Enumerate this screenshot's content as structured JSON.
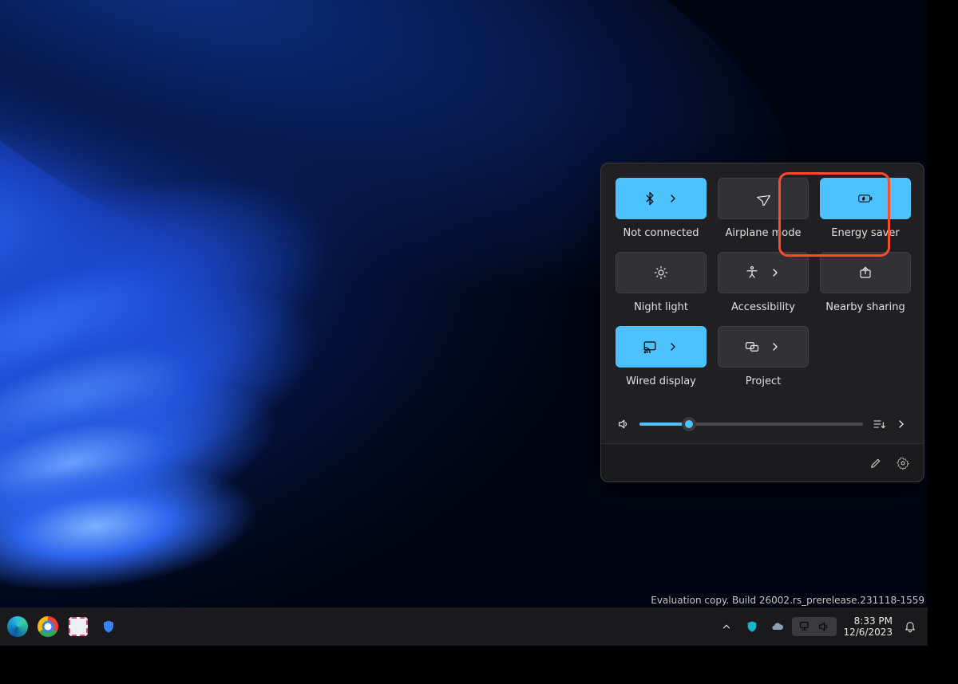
{
  "quick_settings": {
    "tiles": [
      {
        "id": "bluetooth",
        "label": "Not connected",
        "active": true,
        "has_more": true,
        "icon": "bluetooth"
      },
      {
        "id": "airplane",
        "label": "Airplane mode",
        "active": false,
        "has_more": false,
        "icon": "airplane"
      },
      {
        "id": "energy-saver",
        "label": "Energy saver",
        "active": true,
        "has_more": false,
        "icon": "battery-leaf"
      },
      {
        "id": "night-light",
        "label": "Night light",
        "active": false,
        "has_more": false,
        "icon": "brightness"
      },
      {
        "id": "accessibility",
        "label": "Accessibility",
        "active": false,
        "has_more": true,
        "icon": "accessibility"
      },
      {
        "id": "nearby-share",
        "label": "Nearby sharing",
        "active": false,
        "has_more": false,
        "icon": "share"
      },
      {
        "id": "wired-display",
        "label": "Wired display",
        "active": true,
        "has_more": true,
        "icon": "cast"
      },
      {
        "id": "project",
        "label": "Project",
        "active": false,
        "has_more": true,
        "icon": "project"
      }
    ],
    "volume_percent": 22
  },
  "annotation": {
    "highlighted_tile": "energy-saver"
  },
  "watermark": "Evaluation copy. Build 26002.rs_prerelease.231118-1559",
  "taskbar": {
    "time": "8:33 PM",
    "date": "12/6/2023"
  }
}
